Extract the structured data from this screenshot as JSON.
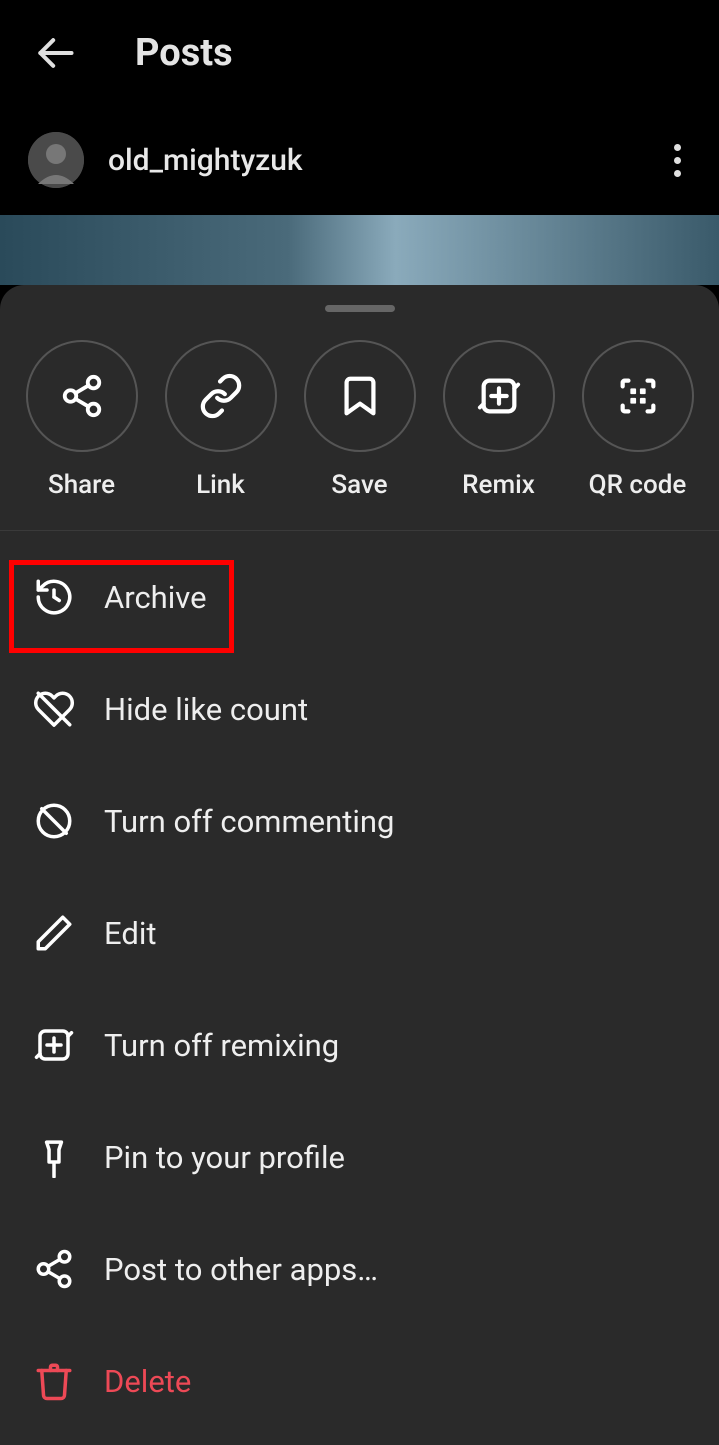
{
  "header": {
    "title": "Posts"
  },
  "post": {
    "username": "old_mightyzuk"
  },
  "actions": {
    "share": "Share",
    "link": "Link",
    "save": "Save",
    "remix": "Remix",
    "qr": "QR code"
  },
  "menu": {
    "archive": "Archive",
    "hide_likes": "Hide like count",
    "turn_off_comment": "Turn off commenting",
    "edit": "Edit",
    "turn_off_remix": "Turn off remixing",
    "pin": "Pin to your profile",
    "post_other": "Post to other apps…",
    "delete": "Delete"
  }
}
